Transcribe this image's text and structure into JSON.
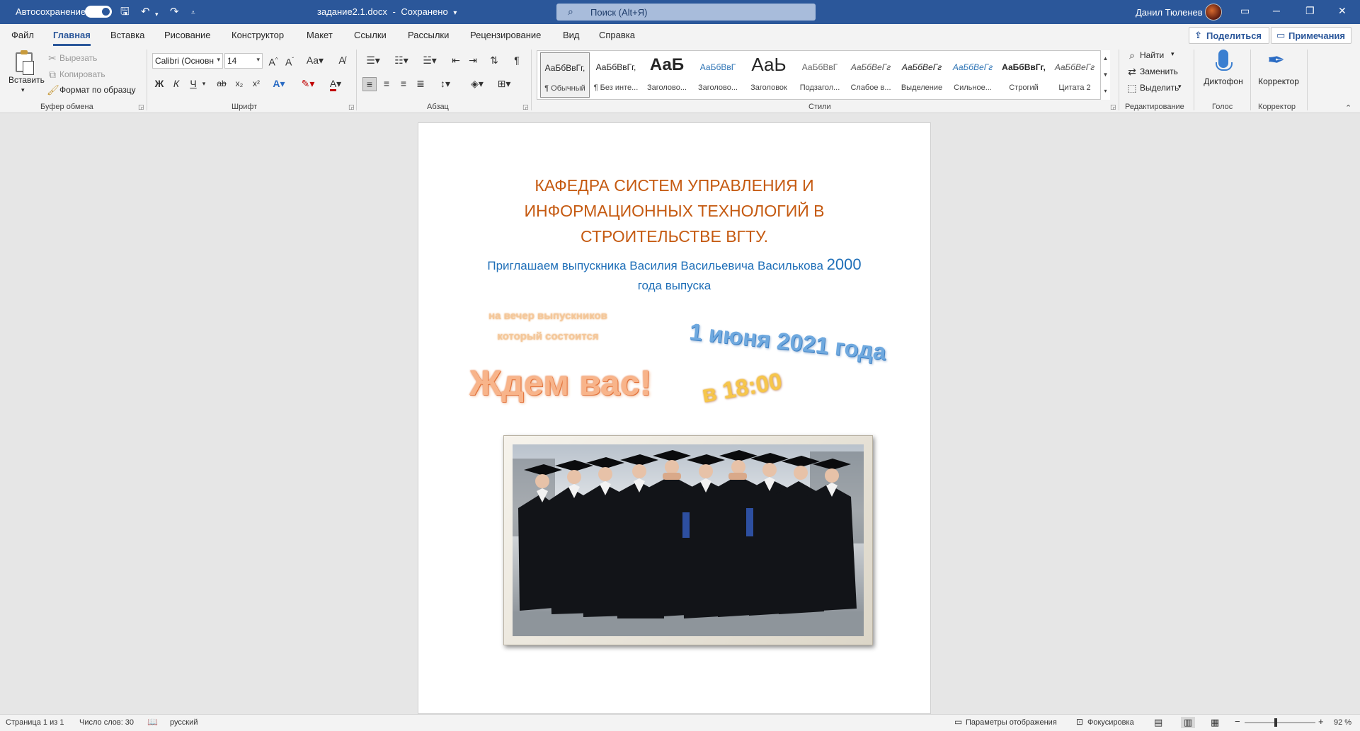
{
  "titlebar": {
    "autosave_label": "Автосохранение",
    "doc_name": "задание2.1.docx",
    "separator": "-",
    "save_state": "Сохранено",
    "search_placeholder": "Поиск (Alt+Я)",
    "user_name": "Данил Тюленев",
    "icons": {
      "save": "save-icon",
      "undo": "undo-icon",
      "redo": "redo-icon",
      "customize": "customize-icon",
      "search": "search-icon",
      "ribbon_display": "ribbon-display-icon",
      "minimize": "minimize-icon",
      "restore": "restore-icon",
      "close": "close-icon"
    }
  },
  "tabs": [
    {
      "label": "Файл"
    },
    {
      "label": "Главная",
      "active": true
    },
    {
      "label": "Вставка"
    },
    {
      "label": "Рисование"
    },
    {
      "label": "Конструктор"
    },
    {
      "label": "Макет"
    },
    {
      "label": "Ссылки"
    },
    {
      "label": "Рассылки"
    },
    {
      "label": "Рецензирование"
    },
    {
      "label": "Вид"
    },
    {
      "label": "Справка"
    }
  ],
  "share_label": "Поделиться",
  "comments_label": "Примечания",
  "clipboard": {
    "paste": "Вставить",
    "cut": "Вырезать",
    "copy": "Копировать",
    "format_painter": "Формат по образцу",
    "group": "Буфер обмена"
  },
  "font": {
    "family": "Calibri (Основн",
    "size": "14",
    "group": "Шрифт",
    "buttons": {
      "bold": "Ж",
      "italic": "К",
      "underline": "Ч",
      "strike": "ab",
      "sub": "x₂",
      "sup": "x²",
      "grow": "A^",
      "shrink": "Aˇ",
      "case": "Aa",
      "color": "A",
      "highlight": "ab"
    }
  },
  "paragraph": {
    "group": "Абзац",
    "pilcrow": "¶"
  },
  "styles": {
    "group": "Стили",
    "items": [
      {
        "preview": "АаБбВвГг,",
        "name": "¶ Обычный",
        "selected": true
      },
      {
        "preview": "АаБбВвГг,",
        "name": "¶ Без инте..."
      },
      {
        "preview": "АаБ",
        "name": "Заголово..."
      },
      {
        "preview": "АаБбВвГ",
        "name": "Заголово..."
      },
      {
        "preview": "АаЬ",
        "name": "Заголовок"
      },
      {
        "preview": "АаБбВвГ",
        "name": "Подзагол..."
      },
      {
        "preview": "АаБбВеГг",
        "name": "Слабое в..."
      },
      {
        "preview": "АаБбВеГг",
        "name": "Выделение"
      },
      {
        "preview": "АаБбВеГг",
        "name": "Сильное..."
      },
      {
        "preview": "АаБбВвГг,",
        "name": "Строгий"
      },
      {
        "preview": "АаБбВеГг",
        "name": "Цитата 2"
      }
    ]
  },
  "editing": {
    "find": "Найти",
    "replace": "Заменить",
    "select": "Выделить",
    "group": "Редактирование"
  },
  "voice": {
    "dictate": "Диктофон",
    "group": "Голос"
  },
  "editor": {
    "label": "Корректор",
    "group": "Корректор"
  },
  "document": {
    "heading_lines": [
      "КАФЕДРА СИСТЕМ УПРАВЛЕНИЯ И",
      "ИНФОРМАЦИОННЫХ ТЕХНОЛОГИЙ В",
      "СТРОИТЕЛЬСТВЕ ВГТУ."
    ],
    "invite_text": "Приглашаем выпускника Василия Васильевича Василькова",
    "invite_year": "2000",
    "invite_tail": "года выпуска",
    "evening_lines": [
      "на вечер выпускников",
      "который состоится"
    ],
    "date_text": "1 июня 2021 года",
    "wait_text": "Ждем вас!",
    "time_text": "в 18:00"
  },
  "status": {
    "page": "Страница 1 из 1",
    "words": "Число слов: 30",
    "language": "русский",
    "display_settings": "Параметры отображения",
    "focus": "Фокусировка",
    "zoom": "92 %",
    "zoom_minus": "−",
    "zoom_plus": "+"
  },
  "colors": {
    "brand": "#2b579a",
    "heading": "#c55a11",
    "invite": "#1f6fb8"
  }
}
